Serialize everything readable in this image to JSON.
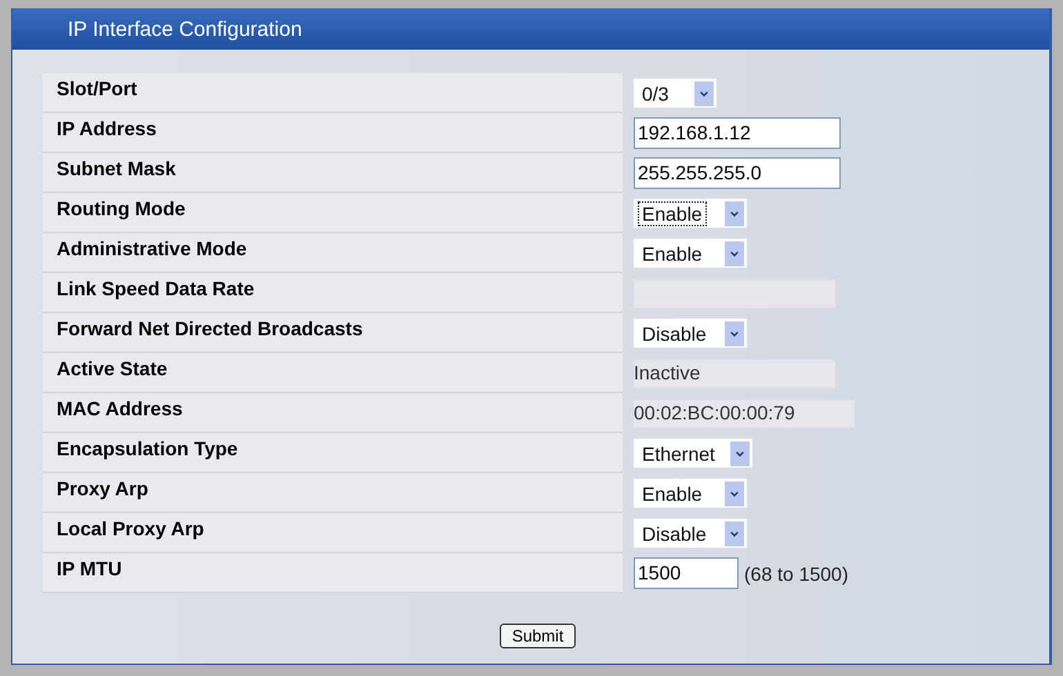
{
  "panel": {
    "title": "IP Interface Configuration"
  },
  "rows": [
    {
      "label": "Slot/Port",
      "kind": "select",
      "value": "0/3",
      "focused": false
    },
    {
      "label": "IP Address",
      "kind": "text",
      "value": "192.168.1.12"
    },
    {
      "label": "Subnet Mask",
      "kind": "text",
      "value": "255.255.255.0"
    },
    {
      "label": "Routing Mode",
      "kind": "select",
      "value": "Enable",
      "focused": true
    },
    {
      "label": "Administrative Mode",
      "kind": "select",
      "value": "Enable",
      "focused": false
    },
    {
      "label": "Link Speed Data Rate",
      "kind": "readonly"
    },
    {
      "label": "Forward Net Directed Broadcasts",
      "kind": "select",
      "value": "Disable",
      "focused": false
    },
    {
      "label": "Active State",
      "kind": "readonly",
      "value": "Inactive"
    },
    {
      "label": "MAC Address",
      "kind": "readonly",
      "value": "00:02:BC:00:00:79"
    },
    {
      "label": "Encapsulation Type",
      "kind": "select",
      "value": "Ethernet",
      "focused": false
    },
    {
      "label": "Proxy Arp",
      "kind": "select",
      "value": "Enable",
      "focused": false
    },
    {
      "label": "Local Proxy Arp",
      "kind": "select",
      "value": "Disable",
      "focused": false
    },
    {
      "label": "IP MTU",
      "kind": "text",
      "value": "1500",
      "hint": "(68 to 1500)"
    }
  ],
  "buttons": [
    "Submit"
  ]
}
